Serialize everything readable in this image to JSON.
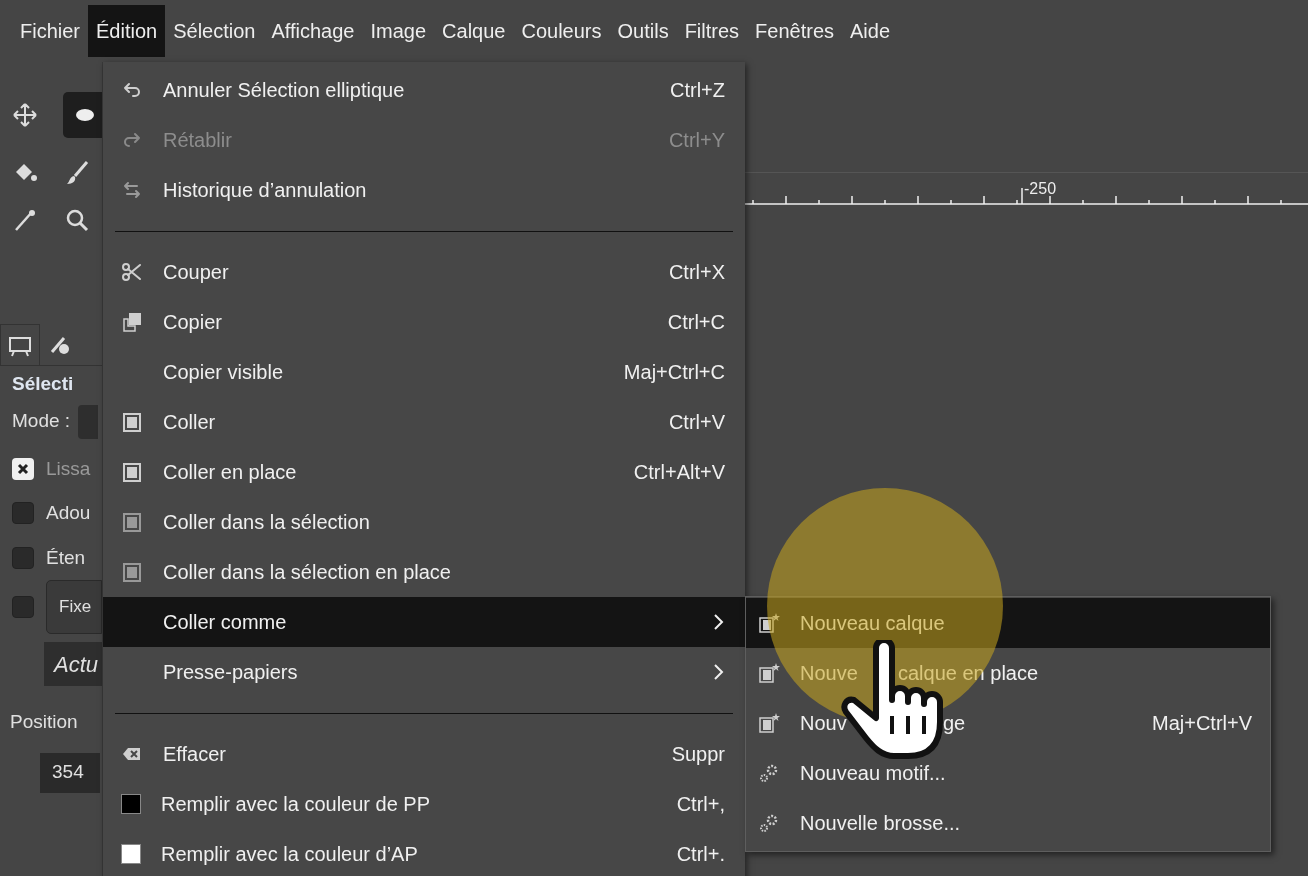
{
  "menubar": [
    {
      "label": "Fichier",
      "selected": false
    },
    {
      "label": "Édition",
      "selected": true
    },
    {
      "label": "Sélection",
      "selected": false
    },
    {
      "label": "Affichage",
      "selected": false
    },
    {
      "label": "Image",
      "selected": false
    },
    {
      "label": "Calque",
      "selected": false
    },
    {
      "label": "Couleurs",
      "selected": false
    },
    {
      "label": "Outils",
      "selected": false
    },
    {
      "label": "Filtres",
      "selected": false
    },
    {
      "label": "Fenêtres",
      "selected": false
    },
    {
      "label": "Aide",
      "selected": false
    }
  ],
  "toolbox": {
    "title": "Sélecti",
    "mode_label": "Mode :",
    "options": [
      {
        "label": "Lissa",
        "checked": true
      },
      {
        "label": "Adou",
        "checked": false
      },
      {
        "label": "Éten",
        "checked": false
      },
      {
        "label": "Fixe",
        "checked": false,
        "kind": "button"
      }
    ],
    "field": "Actu",
    "position_label": "Position",
    "position_value": "354"
  },
  "ruler": {
    "label": "-250"
  },
  "edit_menu": [
    {
      "kind": "item",
      "label": "Annuler Sélection elliptique",
      "shortcut": "Ctrl+Z",
      "disabled": false,
      "selected": false
    },
    {
      "kind": "item",
      "label": "Rétablir",
      "shortcut": "Ctrl+Y",
      "disabled": true,
      "selected": false
    },
    {
      "kind": "item",
      "label": "Historique d’annulation",
      "disabled": false,
      "selected": false
    },
    {
      "kind": "separator"
    },
    {
      "kind": "item",
      "label": "Couper",
      "shortcut": "Ctrl+X",
      "disabled": false,
      "selected": false
    },
    {
      "kind": "item",
      "label": "Copier",
      "shortcut": "Ctrl+C",
      "disabled": false,
      "selected": false
    },
    {
      "kind": "item",
      "label": "Copier visible",
      "shortcut": "Maj+Ctrl+C",
      "disabled": false,
      "selected": false
    },
    {
      "kind": "item",
      "label": "Coller",
      "shortcut": "Ctrl+V",
      "disabled": false,
      "selected": false
    },
    {
      "kind": "item",
      "label": "Coller en place",
      "shortcut": "Ctrl+Alt+V",
      "disabled": false,
      "selected": false
    },
    {
      "kind": "item",
      "label": "Coller dans la sélection",
      "disabled": false,
      "selected": false
    },
    {
      "kind": "item",
      "label": "Coller dans la sélection en place",
      "disabled": false,
      "selected": false
    },
    {
      "kind": "submenu",
      "label": "Coller comme",
      "selected": true
    },
    {
      "kind": "submenu",
      "label": "Presse-papiers",
      "selected": false
    },
    {
      "kind": "separator"
    },
    {
      "kind": "item",
      "label": "Effacer",
      "shortcut": "Suppr",
      "disabled": false,
      "selected": false
    },
    {
      "kind": "swatch",
      "label": "Remplir avec la couleur de PP",
      "shortcut": "Ctrl+,",
      "color": "#000000",
      "selected": false
    },
    {
      "kind": "swatch",
      "label": "Remplir avec la couleur d’AP",
      "shortcut": "Ctrl+.",
      "color": "#ffffff",
      "selected": false
    }
  ],
  "paste_as_menu": [
    {
      "kind": "layer",
      "label": "Nouveau calque",
      "selected": true
    },
    {
      "kind": "layer",
      "label": "Nouve",
      "label_rest": "calque en place",
      "selected": false
    },
    {
      "kind": "layer",
      "label": "Nouv",
      "label_rest": "ge",
      "shortcut": "Maj+Ctrl+V",
      "selected": false
    },
    {
      "kind": "resource",
      "label": "Nouveau motif...",
      "selected": false
    },
    {
      "kind": "resource",
      "label": "Nouvelle brosse...",
      "selected": false
    }
  ]
}
